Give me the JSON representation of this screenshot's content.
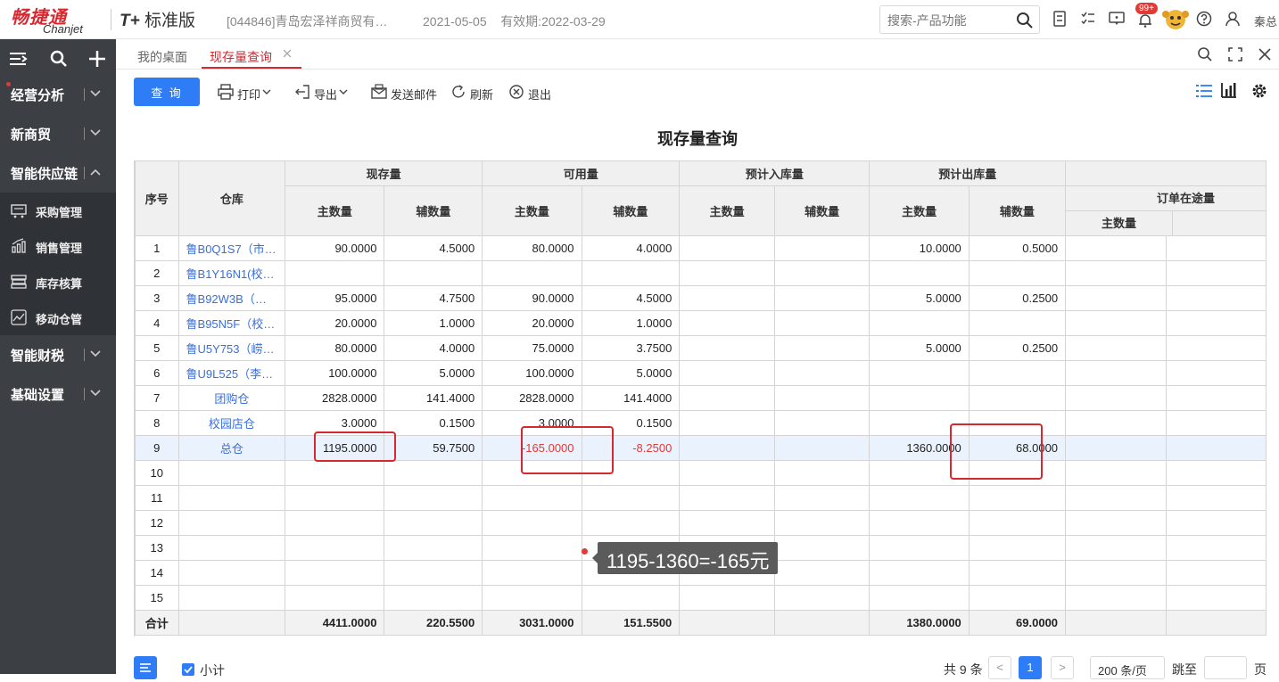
{
  "header": {
    "logo_cn": "畅捷通",
    "logo_en": "Chanjet",
    "product_prefix": "T+",
    "product_name": "标准版",
    "company": "[044846]青岛宏泽祥商贸有…",
    "date": "2021-05-05",
    "expiry": "有效期:2022-03-29",
    "search_placeholder": "搜索-产品功能",
    "notification_badge": "99+",
    "user": "秦总"
  },
  "sidebar": {
    "groups": [
      {
        "label": "经营分析"
      },
      {
        "label": "新商贸"
      },
      {
        "label": "智能供应链"
      },
      {
        "label": "智能财税"
      },
      {
        "label": "基础设置"
      }
    ],
    "supply_chain_items": [
      {
        "label": "采购管理",
        "icon": "cart-icon"
      },
      {
        "label": "销售管理",
        "icon": "sales-chart-icon"
      },
      {
        "label": "库存核算",
        "icon": "inventory-icon"
      },
      {
        "label": "移动仓管",
        "icon": "mobile-warehouse-icon"
      }
    ]
  },
  "tabs": [
    {
      "label": "我的桌面"
    },
    {
      "label": "现存量查询",
      "active": true
    }
  ],
  "toolbar": {
    "query": "查 询",
    "print": "打印",
    "export": "导出",
    "send_mail": "发送邮件",
    "refresh": "刷新",
    "exit": "退出"
  },
  "page_title": "现存量查询",
  "table": {
    "col_seq": "序号",
    "col_warehouse": "仓库",
    "group_headers": [
      "现存量",
      "可用量",
      "预计入库量",
      "预计出库量",
      "订单在途量"
    ],
    "sub_main": "主数量",
    "sub_aux": "辅数量",
    "rows": [
      {
        "seq": "1",
        "warehouse": "鲁B0Q1S7（市…",
        "cur_main": "90.0000",
        "cur_aux": "4.5000",
        "avail_main": "80.0000",
        "avail_aux": "4.0000",
        "in_main": "",
        "in_aux": "",
        "out_main": "10.0000",
        "out_aux": "0.5000",
        "order_main": ""
      },
      {
        "seq": "2",
        "warehouse": "鲁B1Y16N1(校…",
        "cur_main": "",
        "cur_aux": "",
        "avail_main": "",
        "avail_aux": "",
        "in_main": "",
        "in_aux": "",
        "out_main": "",
        "out_aux": "",
        "order_main": ""
      },
      {
        "seq": "3",
        "warehouse": "鲁B92W3B（…",
        "cur_main": "95.0000",
        "cur_aux": "4.7500",
        "avail_main": "90.0000",
        "avail_aux": "4.5000",
        "in_main": "",
        "in_aux": "",
        "out_main": "5.0000",
        "out_aux": "0.2500",
        "order_main": ""
      },
      {
        "seq": "4",
        "warehouse": "鲁B95N5F（校…",
        "cur_main": "20.0000",
        "cur_aux": "1.0000",
        "avail_main": "20.0000",
        "avail_aux": "1.0000",
        "in_main": "",
        "in_aux": "",
        "out_main": "",
        "out_aux": "",
        "order_main": ""
      },
      {
        "seq": "5",
        "warehouse": "鲁U5Y753（崂…",
        "cur_main": "80.0000",
        "cur_aux": "4.0000",
        "avail_main": "75.0000",
        "avail_aux": "3.7500",
        "in_main": "",
        "in_aux": "",
        "out_main": "5.0000",
        "out_aux": "0.2500",
        "order_main": ""
      },
      {
        "seq": "6",
        "warehouse": "鲁U9L525（李…",
        "cur_main": "100.0000",
        "cur_aux": "5.0000",
        "avail_main": "100.0000",
        "avail_aux": "5.0000",
        "in_main": "",
        "in_aux": "",
        "out_main": "",
        "out_aux": "",
        "order_main": ""
      },
      {
        "seq": "7",
        "warehouse": "团购仓",
        "cur_main": "2828.0000",
        "cur_aux": "141.4000",
        "avail_main": "2828.0000",
        "avail_aux": "141.4000",
        "in_main": "",
        "in_aux": "",
        "out_main": "",
        "out_aux": "",
        "order_main": ""
      },
      {
        "seq": "8",
        "warehouse": "校园店仓",
        "cur_main": "3.0000",
        "cur_aux": "0.1500",
        "avail_main": "3.0000",
        "avail_aux": "0.1500",
        "in_main": "",
        "in_aux": "",
        "out_main": "",
        "out_aux": "",
        "order_main": ""
      },
      {
        "seq": "9",
        "warehouse": "总仓",
        "cur_main": "1195.0000",
        "cur_aux": "59.7500",
        "avail_main": "-165.0000",
        "avail_aux": "-8.2500",
        "in_main": "",
        "in_aux": "",
        "out_main": "1360.0000",
        "out_aux": "68.0000",
        "order_main": ""
      },
      {
        "seq": "10"
      },
      {
        "seq": "11"
      },
      {
        "seq": "12"
      },
      {
        "seq": "13"
      },
      {
        "seq": "14"
      },
      {
        "seq": "15"
      }
    ],
    "total": {
      "label": "合计",
      "cur_main": "4411.0000",
      "cur_aux": "220.5500",
      "avail_main": "3031.0000",
      "avail_aux": "151.5500",
      "in_main": "",
      "in_aux": "",
      "out_main": "1380.0000",
      "out_aux": "69.0000",
      "order_main": ""
    }
  },
  "annotation": "1195-1360=-165元",
  "footer": {
    "subtotal": "小计",
    "total_count": "共 9 条",
    "prev": "<",
    "current_page": "1",
    "next": ">",
    "page_size": "200 条/页",
    "jump": "跳至",
    "page_unit": "页"
  },
  "colors": {
    "brand": "#d7282f",
    "primary": "#2e7df6",
    "sidebar_bg": "#3c3f44",
    "negative": "#e53935",
    "link": "#3a6fd8"
  }
}
